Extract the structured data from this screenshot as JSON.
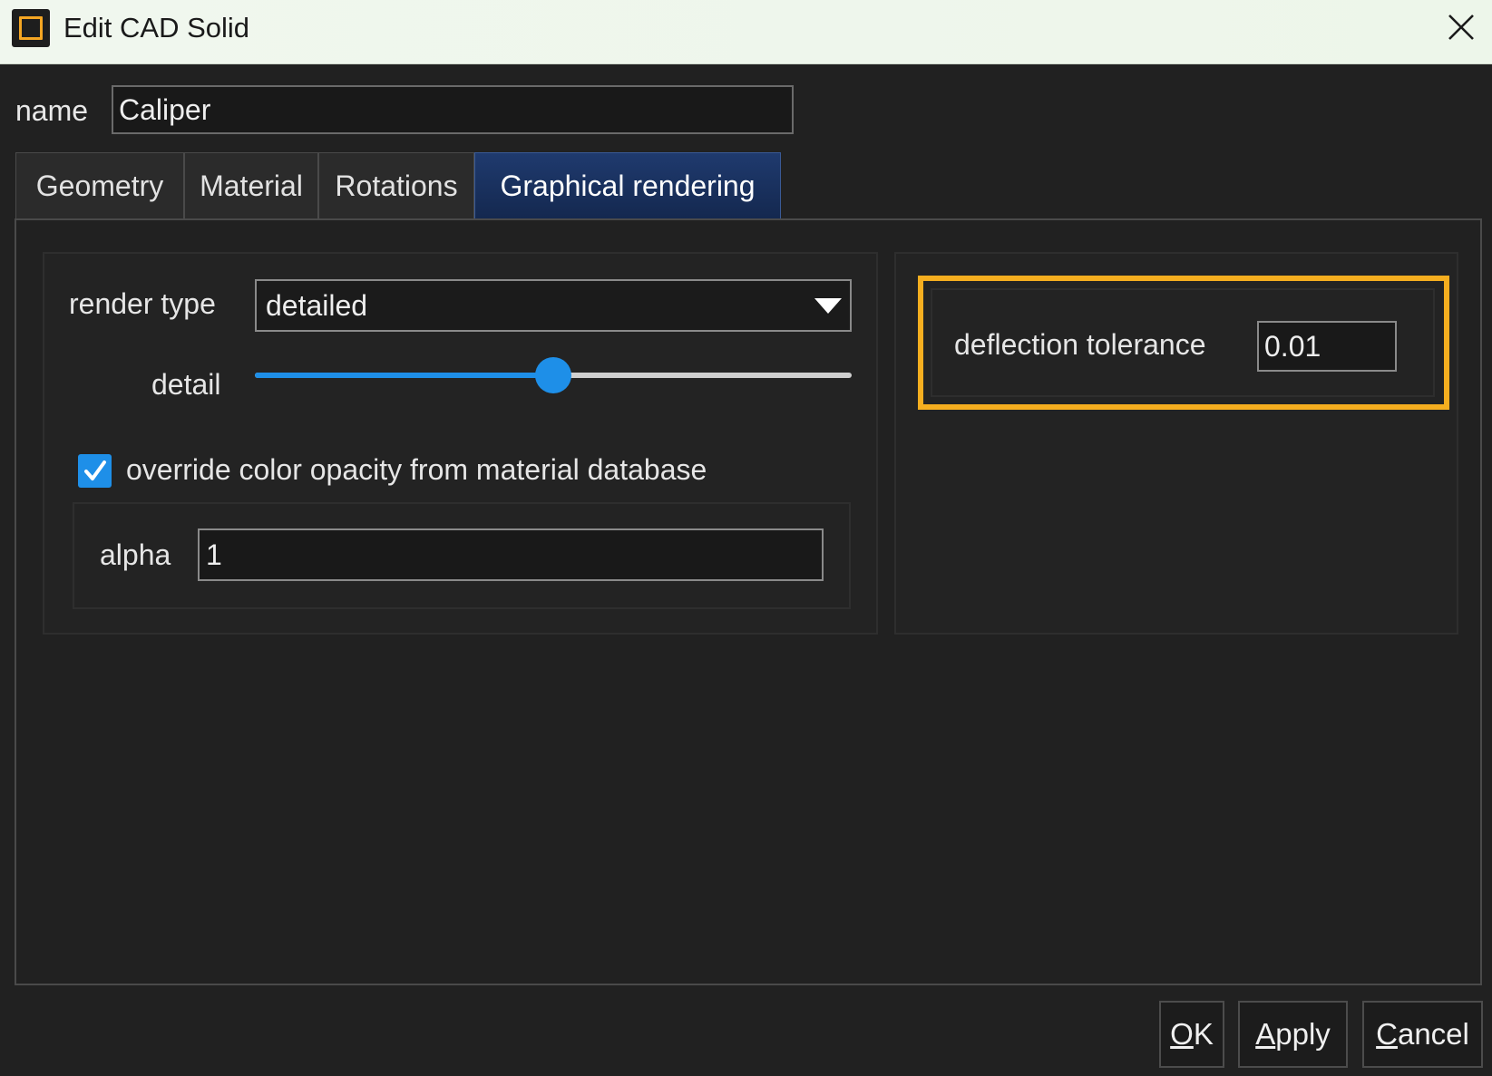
{
  "window": {
    "title": "Edit CAD Solid",
    "close_icon": "close-icon",
    "app_icon": "app-window-icon"
  },
  "name": {
    "label": "name",
    "value": "Caliper"
  },
  "tabs": [
    {
      "label": "Geometry",
      "active": false
    },
    {
      "label": "Material",
      "active": false
    },
    {
      "label": "Rotations",
      "active": false
    },
    {
      "label": "Graphical rendering",
      "active": true
    }
  ],
  "rendering": {
    "render_type_label": "render type",
    "render_type_value": "detailed",
    "detail_label": "detail",
    "detail_fraction": 0.5,
    "override_checked": true,
    "override_label": "override color opacity from material database",
    "alpha_label": "alpha",
    "alpha_value": "1",
    "deflection_label": "deflection tolerance",
    "deflection_value": "0.01"
  },
  "buttons": {
    "ok_mnemonic": "O",
    "ok_rest": "K",
    "apply_mnemonic": "A",
    "apply_rest": "pply",
    "cancel_mnemonic": "C",
    "cancel_rest": "ancel"
  },
  "colors": {
    "accent": "#1e8fe8",
    "highlight": "#f5ae1f",
    "active_tab": "#1f3a6e",
    "background": "#212121"
  }
}
